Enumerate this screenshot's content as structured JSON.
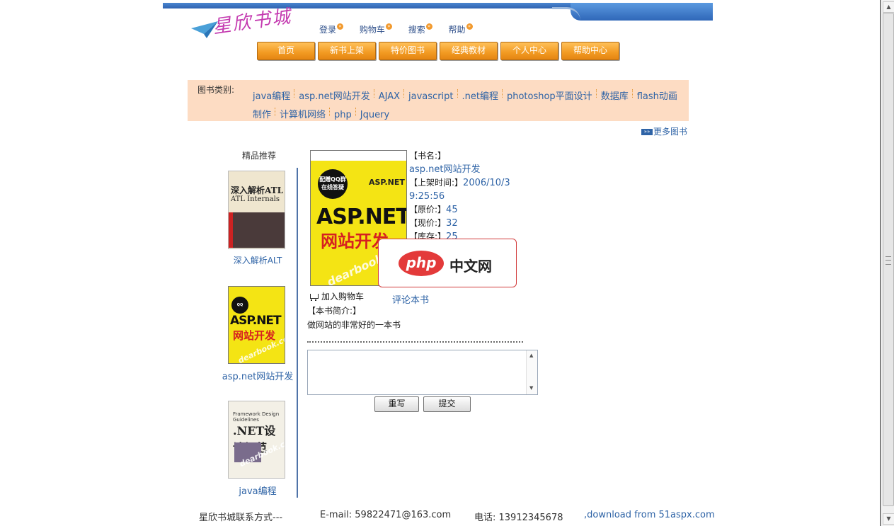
{
  "header": {
    "logo_text": "星欣书城",
    "top_links": [
      "登录",
      "购物车",
      "搜索",
      "帮助"
    ],
    "nav": [
      "首页",
      "新书上架",
      "特价图书",
      "经典教材",
      "个人中心",
      "帮助中心"
    ]
  },
  "categories": {
    "label": "图书类别:",
    "items": [
      "java编程",
      "asp.net网站开发",
      "AJAX",
      "javascript",
      ".net编程",
      "photoshop平面设计",
      "数据库",
      "flash动画制作",
      "计算机网络",
      "php",
      "Jquery"
    ],
    "more": "更多图书"
  },
  "recommend": {
    "title": "精品推荐",
    "items": [
      {
        "name": "深入解析ALT",
        "cover_line1": "深入解析ATL",
        "cover_line2": "ATL Internals"
      },
      {
        "name": "asp.net网站开发",
        "cover_line1": "ASP.NET",
        "cover_line2": "网站开发"
      },
      {
        "name": "java编程",
        "cover_line1": "Framework Design Guidelines",
        "cover_line2": ".NET设计规范"
      }
    ]
  },
  "book": {
    "cover_title1": "ASP.NET",
    "cover_title2": "网站开发",
    "cover_badge": "配赠QQ群在线答疑",
    "cover_corner": "ASP.NET",
    "cover_watermark": "dearbook.com",
    "name_label": "【书名:】",
    "name": "asp.net网站开发",
    "date_label": "【上架时间:】",
    "date": "2006/10/3 9:25:56",
    "orig_price_label": "【原价:】",
    "orig_price": "45",
    "price_label": "【现价:】",
    "price": "32",
    "stock_label": "【库存:】",
    "stock": "25",
    "add_to_cart": "加入购物车",
    "review": "评论本书",
    "intro_label": "【本书简介:】",
    "intro": "做网站的非常好的一本书"
  },
  "comment": {
    "reset_label": "重写",
    "submit_label": "提交"
  },
  "overlay": {
    "brand": "php",
    "cn": "中文网"
  },
  "footer": {
    "contact": "星欣书城联系方式---",
    "email": "E-mail: 59822471@163.com",
    "phone": "电话: 13912345678",
    "download": ",download from 51aspx.com"
  }
}
